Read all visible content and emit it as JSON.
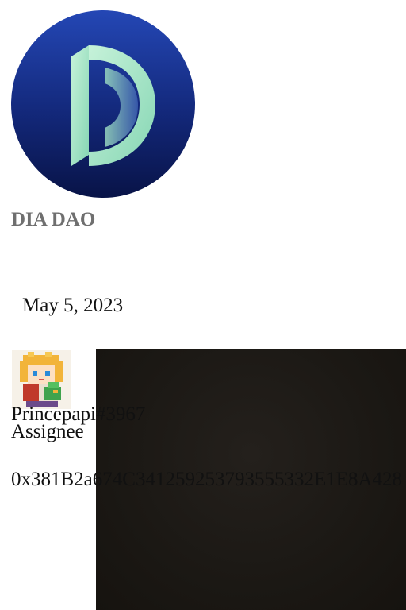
{
  "org": {
    "name": "DIA DAO",
    "logo_icon": "dia-logo-icon"
  },
  "event": {
    "date": "May 5, 2023"
  },
  "assignee": {
    "avatar_icon": "pixel-character-avatar",
    "username": "Princepapi#3967",
    "role_label": "Assignee",
    "wallet_address": "0x381B2a674C341259253793555332E1E8A428"
  },
  "colors": {
    "logo_bg_top": "#1f3fa8",
    "logo_bg_bottom": "#0a1650",
    "logo_letter": "#a8e6c8",
    "org_name": "#6f6f6f",
    "panel_bg": "#1b1814"
  }
}
